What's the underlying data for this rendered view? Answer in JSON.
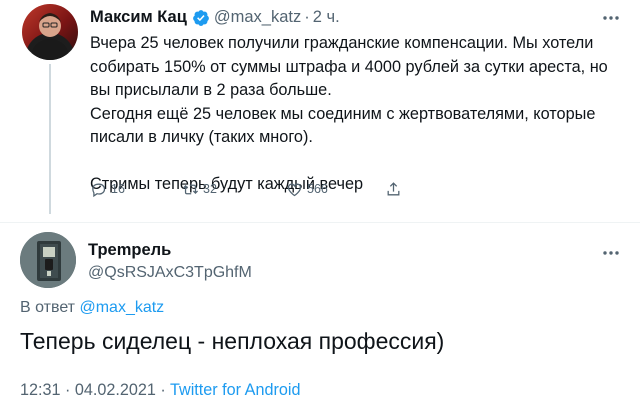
{
  "tweet1": {
    "author_name": "Максим Кац",
    "handle": "@max_katz",
    "separator": "·",
    "time": "2 ч.",
    "more_icon": "more-horizontal-icon",
    "text_lines": [
      "Вчера 25 человек получили гражданские компенсации. Мы хотели собирать 150% от суммы штрафа и 4000 рублей за сутки ареста, но вы присылали в 2 раза больше.",
      "Сегодня ещё 25 человек мы соединим с жертвователями, которые писали в личку (таких много).",
      "Стримы теперь будут каждый вечер"
    ],
    "replies_count": "16",
    "retweets_count": "32",
    "likes_count": "566"
  },
  "tweet2": {
    "author_name": "Трempель",
    "handle": "@QsRSJAxC3TpGhfM",
    "reply_prefix": "В ответ",
    "reply_mention": "@max_katz",
    "text": "Теперь сиделец - неплохая профессия)",
    "date_time": "12:31 · 04.02.2021",
    "meta_separator": " · ",
    "source": "Twitter for Android"
  },
  "colors": {
    "text": "#0f1419",
    "secondary": "#536471",
    "accent": "#1d9bf0",
    "divider": "#eff3f4"
  }
}
